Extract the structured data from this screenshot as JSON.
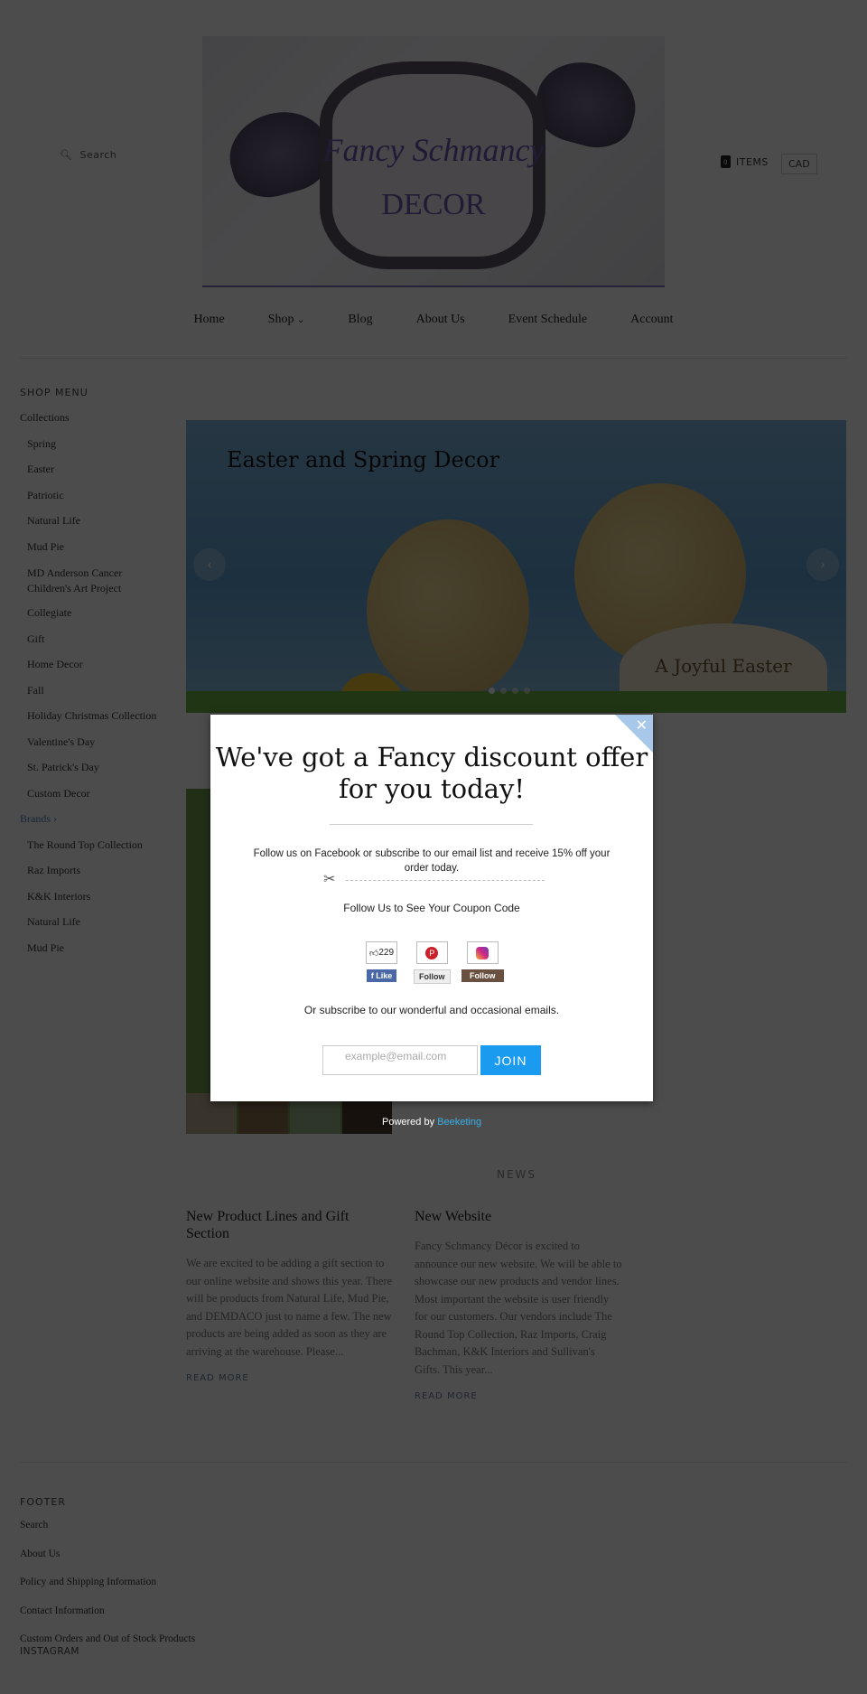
{
  "header": {
    "search_label": "Search",
    "cart_count": "0",
    "cart_label": "ITEMS",
    "currency": "CAD",
    "logo_text": [
      "Fancy Schmancy",
      "DECOR"
    ]
  },
  "nav": [
    {
      "label": "Home"
    },
    {
      "label": "Shop"
    },
    {
      "label": "Blog"
    },
    {
      "label": "About Us"
    },
    {
      "label": "Event Schedule"
    },
    {
      "label": "Account"
    }
  ],
  "sidebar": {
    "heading": "SHOP MENU",
    "items": [
      {
        "label": "Collections",
        "sub": false
      },
      {
        "label": "Spring",
        "sub": true
      },
      {
        "label": "Easter",
        "sub": true
      },
      {
        "label": "Patriotic",
        "sub": true
      },
      {
        "label": "Natural Life",
        "sub": true
      },
      {
        "label": "Mud Pie",
        "sub": true
      },
      {
        "label": "MD Anderson Cancer Children's Art Project",
        "sub": true
      },
      {
        "label": "Collegiate",
        "sub": true
      },
      {
        "label": "Gift",
        "sub": true
      },
      {
        "label": "Home Decor",
        "sub": true
      },
      {
        "label": "Fall",
        "sub": true
      },
      {
        "label": "Holiday Christmas Collection",
        "sub": true
      },
      {
        "label": "Valentine's Day",
        "sub": true
      },
      {
        "label": "St. Patrick's Day",
        "sub": true
      },
      {
        "label": "Custom Decor",
        "sub": true
      },
      {
        "label": "Brands",
        "sub": false
      },
      {
        "label": "The Round Top Collection",
        "sub": true
      },
      {
        "label": "Raz Imports",
        "sub": true
      },
      {
        "label": "K&K Interiors",
        "sub": true
      },
      {
        "label": "Natural Life",
        "sub": true
      },
      {
        "label": "Mud Pie",
        "sub": true
      }
    ]
  },
  "slider": {
    "title": "Easter and Spring Decor",
    "image_text": "A Joyful Easter",
    "slide_count": 4,
    "active_slide": 1
  },
  "news": {
    "heading": "NEWS",
    "posts": [
      {
        "title": "New Product Lines and Gift Section",
        "excerpt": "We are excited to be adding a gift section to our online website and shows this year.  There will be products from Natural Life, Mud Pie, and DEMDACO just to name a few.   The new products are being added as soon as they are arriving at the warehouse.  Please...",
        "link": "READ MORE"
      },
      {
        "title": "New Website",
        "excerpt": "Fancy Schmancy Décor is excited to announce our new website. We will be able to showcase our new products and vendor lines. Most important the website is user friendly for our customers. Our vendors include The Round Top Collection, Raz Imports, Craig Bachman, K&K Interiors and Sullivan's Gifts.  This year...",
        "link": "READ MORE"
      }
    ]
  },
  "footer": {
    "heading": "FOOTER",
    "items": [
      "Search",
      "About Us",
      "Policy and Shipping Information",
      "Contact Information",
      "Custom Orders and Out of Stock Products"
    ],
    "instagram": "INSTAGRAM"
  },
  "popup": {
    "title": "We've got a Fancy discount offer for you today!",
    "text": "Follow us on Facebook or subscribe to our email list and receive 15% off your order today.",
    "follow_text": "Follow Us to See Your Coupon Code",
    "facebook_count": "229",
    "facebook_btn": "Like",
    "pinterest_btn": "Follow",
    "instagram_btn": "Follow",
    "subscribe_text": "Or subscribe to our wonderful and occasional emails.",
    "email_placeholder": "example@email.com",
    "join_label": "JOIN",
    "powered_by": "Powered by",
    "powered_link": "Beeketing",
    "accent": "#1a9bf0"
  }
}
